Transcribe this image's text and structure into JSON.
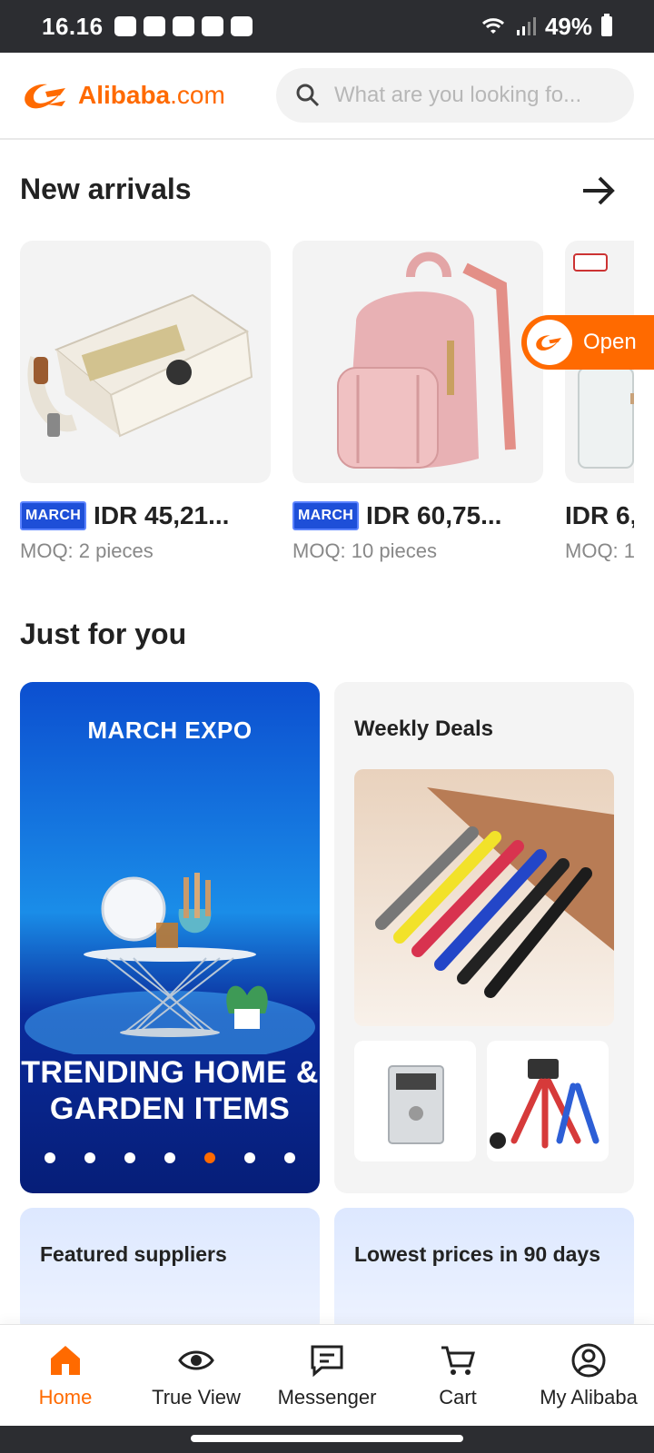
{
  "status_bar": {
    "time": "16.16",
    "battery": "49%"
  },
  "header": {
    "logo_brand": "Alibaba",
    "logo_domain": ".com",
    "search_placeholder": "What are you looking fo..."
  },
  "new_arrivals": {
    "title": "New arrivals",
    "items": [
      {
        "badge": "MARCH",
        "price": "IDR 45,21...",
        "moq": "MOQ: 2 pieces"
      },
      {
        "badge": "MARCH",
        "price": "IDR 60,75...",
        "moq": "MOQ: 10 pieces"
      },
      {
        "badge": "",
        "price": "IDR 6,",
        "moq": "MOQ: 1"
      }
    ]
  },
  "open_button": {
    "label": "Open"
  },
  "just_for_you": {
    "title": "Just for you",
    "banner": {
      "expo_label": "MARCH EXPO",
      "line1": "TRENDING HOME &",
      "line2": "GARDEN ITEMS",
      "dot_count": 7,
      "active_dot": 5
    },
    "weekly_deals": {
      "title": "Weekly Deals"
    },
    "featured_suppliers": {
      "title": "Featured suppliers"
    },
    "lowest_prices": {
      "title": "Lowest prices in 90 days"
    }
  },
  "bottom_nav": {
    "items": [
      {
        "label": "Home",
        "icon": "home-icon",
        "active": true
      },
      {
        "label": "True View",
        "icon": "eye-icon",
        "active": false
      },
      {
        "label": "Messenger",
        "icon": "message-icon",
        "active": false
      },
      {
        "label": "Cart",
        "icon": "cart-icon",
        "active": false
      },
      {
        "label": "My Alibaba",
        "icon": "profile-icon",
        "active": false
      }
    ]
  },
  "colors": {
    "brand": "#ff6a00",
    "badge": "#1e4fd8",
    "text": "#222222",
    "muted": "#888888"
  }
}
